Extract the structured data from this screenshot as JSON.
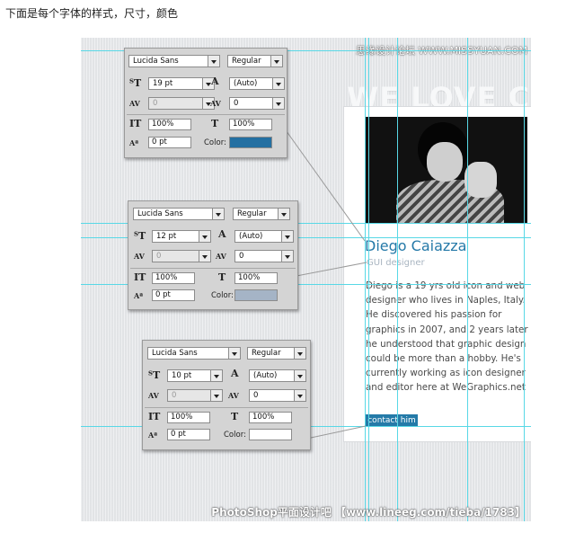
{
  "caption": "下面是每个字体的样式，尺寸，颜色",
  "watermark_top": "思缘设计论坛 WWW.MISSYUAN.COM",
  "watermark_bottom": "PhotoShop平面设计吧 【www.lineeg.com/tieba/1783】",
  "headline": "WE LOVE CR",
  "profile": {
    "name": "Diego Caiazza",
    "role": "GUI designer",
    "bio": "Diego is a 19 yrs old icon and web designer who lives in Naples, Italy. He discovered his passion for graphics in 2007, and 2 years later he understood that graphic design could be more than a hobby. He's currently working as icon designer and editor here at WeGraphics.net",
    "contact_label": "contact him"
  },
  "panels": [
    {
      "font": "Lucida Sans",
      "style": "Regular",
      "size": "19 pt",
      "leading": "(Auto)",
      "kerning": "0",
      "tracking": "0",
      "vscale": "100%",
      "hscale": "100%",
      "baseline": "0 pt",
      "color_label": "Color:",
      "color": "#2470a2"
    },
    {
      "font": "Lucida Sans",
      "style": "Regular",
      "size": "12 pt",
      "leading": "(Auto)",
      "kerning": "0",
      "tracking": "0",
      "vscale": "100%",
      "hscale": "100%",
      "baseline": "0 pt",
      "color_label": "Color:",
      "color": "#a5b4c6"
    },
    {
      "font": "Lucida Sans",
      "style": "Regular",
      "size": "10 pt",
      "leading": "(Auto)",
      "kerning": "0",
      "tracking": "0",
      "vscale": "100%",
      "hscale": "100%",
      "baseline": "0 pt",
      "color_label": "Color:",
      "color": "#ffffff"
    }
  ],
  "guide_color": "#58d8e6"
}
